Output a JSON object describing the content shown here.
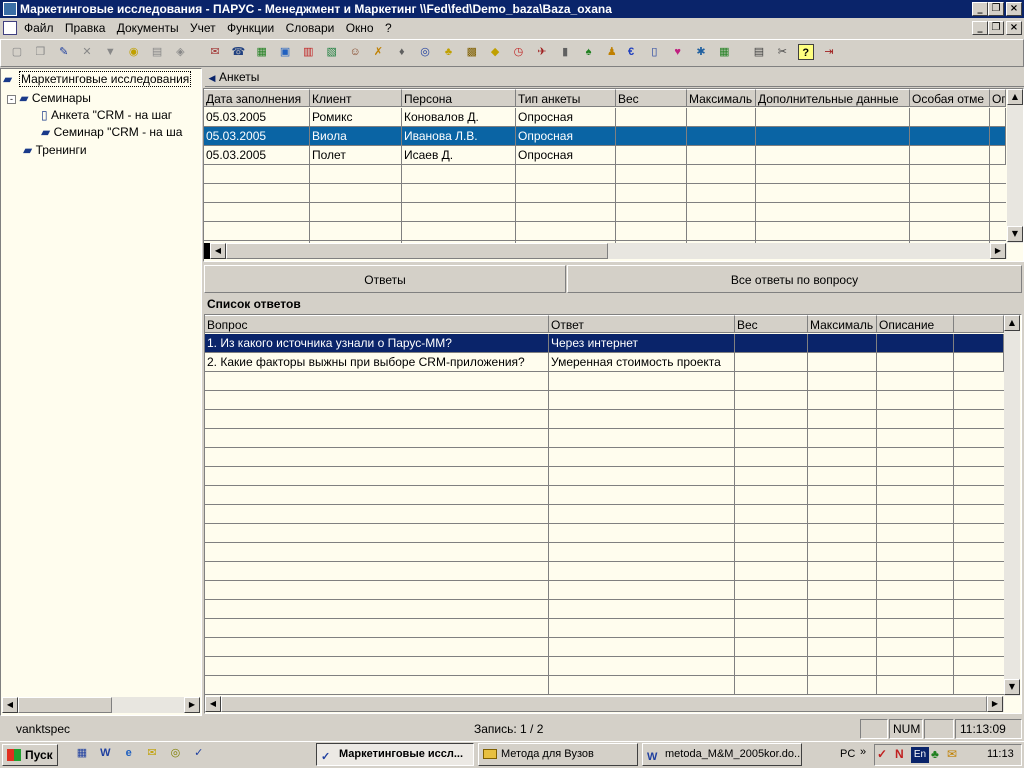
{
  "window": {
    "title": "Маркетинговые исследования - ПАРУС - Менеджмент и Маркетинг  \\\\Fed\\fed\\Demo_baza\\Baza_oxana"
  },
  "menu": [
    "Файл",
    "Правка",
    "Документы",
    "Учет",
    "Функции",
    "Словари",
    "Окно",
    "?"
  ],
  "tree": {
    "header": "Маркетинговые исследования",
    "items": [
      {
        "label": "Семинары"
      },
      {
        "label": "Анкета \"CRM - на шаг"
      },
      {
        "label": "Семинар \"CRM - на ша"
      },
      {
        "label": "Тренинги"
      }
    ]
  },
  "upper": {
    "header": "Анкеты",
    "columns": [
      "Дата заполнения",
      "Клиент",
      "Персона",
      "Тип анкеты",
      "Вес",
      "Максималь",
      "Дополнительные данные",
      "Особая отме",
      "Оп"
    ],
    "rows": [
      [
        "05.03.2005",
        "Ромикс",
        "Коновалов Д.",
        "Опросная",
        "",
        "",
        "",
        ""
      ],
      [
        "05.03.2005",
        "Виола",
        "Иванова Л.В.",
        "Опросная",
        "",
        "",
        "",
        ""
      ],
      [
        "05.03.2005",
        "Полет",
        "Исаев Д.",
        "Опросная",
        "",
        "",
        "",
        ""
      ]
    ]
  },
  "tabs": [
    "Ответы",
    "Все ответы по вопросу"
  ],
  "lower": {
    "caption": "Список ответов",
    "columns": [
      "Вопрос",
      "Ответ",
      "Вес",
      "Максималь",
      "Описание"
    ],
    "rows": [
      [
        "1. Из какого источника узнали о Парус-ММ?",
        "Через интернет",
        "",
        "",
        ""
      ],
      [
        "2. Какие факторы выжны при выборе CRM-приложения?",
        "Умеренная стоимость проекта",
        "",
        "",
        ""
      ]
    ]
  },
  "status": {
    "user": "vanktspec",
    "record": "Запись: 1 / 2",
    "num": "NUM",
    "time": "11:13:09"
  },
  "taskbar": {
    "start": "Пуск",
    "tasks": [
      "Маркетинговые иссл...",
      "Метода для Вузов",
      "metoda_M&M_2005kor.do..."
    ],
    "lang_label": "PC",
    "lang": "En",
    "clock": "11:13"
  },
  "colors": {
    "title": "#0a246a",
    "grid_bg": "#fffdee",
    "selection": "#0a246a",
    "selection_upper": "#0a64a4"
  }
}
